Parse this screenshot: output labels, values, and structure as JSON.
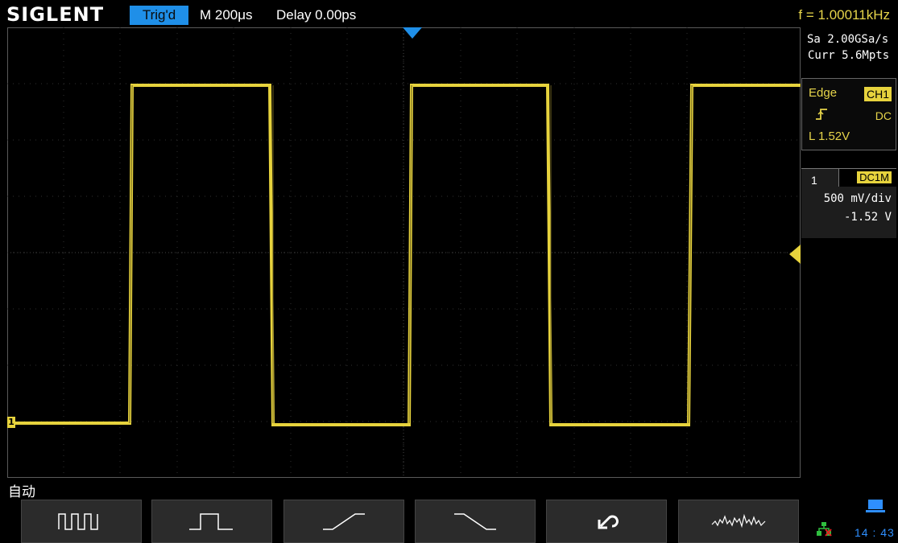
{
  "header": {
    "brand": "SIGLENT",
    "trigger_status": "Trig'd",
    "timebase": "M 200μs",
    "delay": "Delay 0.00ps",
    "frequency": "f = 1.00011kHz"
  },
  "acquisition": {
    "sample_rate": "Sa 2.00GSa/s",
    "memory_depth": "Curr 5.6Mpts"
  },
  "trigger_panel": {
    "type": "Edge",
    "source": "CH1",
    "slope_icon": "rising-edge-icon",
    "coupling": "DC",
    "level": "L  1.52V"
  },
  "channel_panel": {
    "channel_number": "1",
    "coupling_impedance": "DC1M",
    "scale": "500 mV/div",
    "offset": "-1.52 V"
  },
  "softkey_menu": {
    "title": "自动",
    "keys": [
      {
        "name": "multi-period-icon"
      },
      {
        "name": "single-period-icon"
      },
      {
        "name": "rising-edge-icon"
      },
      {
        "name": "falling-edge-icon"
      },
      {
        "name": "undo-icon"
      },
      {
        "name": "noise-waveform-icon"
      }
    ]
  },
  "status": {
    "time": "14 : 43",
    "network_icon": "network-disconnected-icon",
    "usb_icon": "usb-device-icon"
  },
  "colors": {
    "channel1": "#e7d33d",
    "accent_blue": "#1f8fe8",
    "grid": "#3a3a3a",
    "background": "#000000"
  }
}
